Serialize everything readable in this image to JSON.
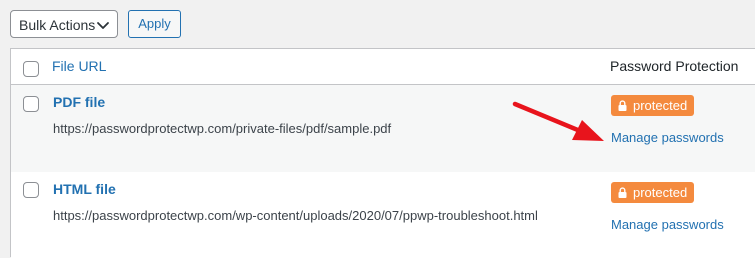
{
  "toolbar": {
    "bulk_actions_label": "Bulk Actions",
    "apply_label": "Apply"
  },
  "table": {
    "columns": [
      "File URL",
      "Password Protection"
    ],
    "rows": [
      {
        "title": "PDF file",
        "url": "https://passwordprotectwp.com/private-files/pdf/sample.pdf",
        "status": "protected",
        "action": "Manage passwords"
      },
      {
        "title": "HTML file",
        "url": "https://passwordprotectwp.com/wp-content/uploads/2020/07/ppwp-troubleshoot.html",
        "status": "protected",
        "action": "Manage passwords"
      }
    ]
  },
  "colors": {
    "accent": "#2271b1",
    "badge": "#f48a3e",
    "arrow": "#e8141c"
  },
  "icons": [
    "chevron-down-icon",
    "lock-icon",
    "red-arrow-annotation"
  ]
}
